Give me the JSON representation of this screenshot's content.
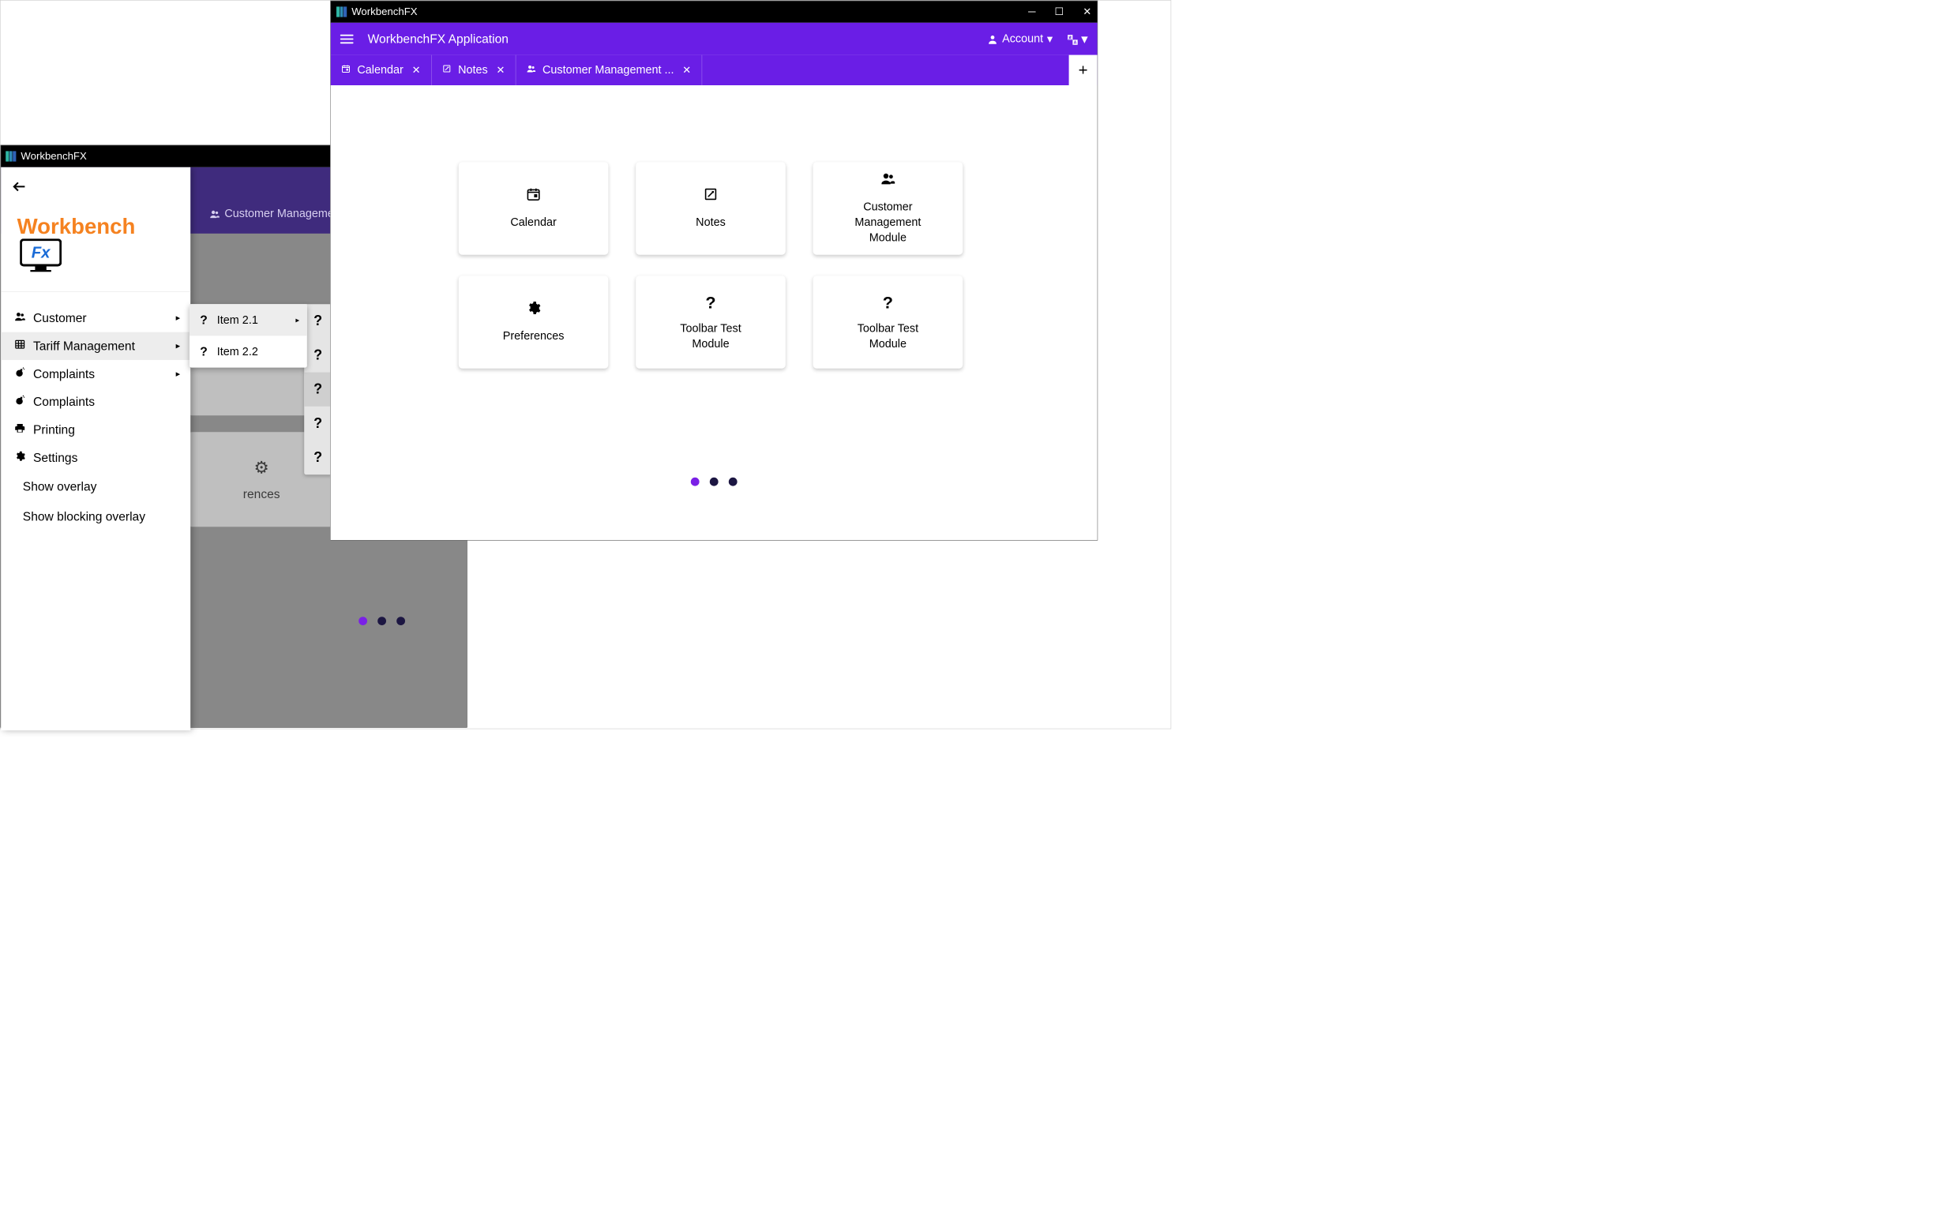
{
  "colors": {
    "accent": "#6a1ee6",
    "accent_dark": "#3f2b7d",
    "dot_active": "#7a20e6",
    "dot_dark": "#1c1642"
  },
  "back_window": {
    "title": "WorkbenchFX",
    "tab_remnant": "Customer Managemen",
    "tile_label": "rences",
    "submenu_placeholders": [
      "?",
      "?",
      "?",
      "?",
      "?"
    ],
    "logo_text": "Workbench",
    "drawer": {
      "items": [
        {
          "icon": "people",
          "label": "Customer",
          "has_children": true
        },
        {
          "icon": "grid",
          "label": "Tariff Management",
          "has_children": true,
          "active": true
        },
        {
          "icon": "bomb",
          "label": "Complaints",
          "has_children": true
        },
        {
          "icon": "bomb",
          "label": "Complaints",
          "has_children": false
        },
        {
          "icon": "print",
          "label": "Printing",
          "has_children": false
        },
        {
          "icon": "gear",
          "label": "Settings",
          "has_children": false
        }
      ],
      "plain": [
        "Show overlay",
        "Show blocking overlay"
      ]
    },
    "flyout": [
      {
        "label": "Item 2.1",
        "has_children": true,
        "active": true
      },
      {
        "label": "Item 2.2",
        "has_children": false
      }
    ]
  },
  "front_window": {
    "title": "WorkbenchFX",
    "app_title": "WorkbenchFX Application",
    "account_label": "Account",
    "tabs": [
      {
        "icon": "calendar",
        "label": "Calendar"
      },
      {
        "icon": "note",
        "label": "Notes"
      },
      {
        "icon": "people",
        "label": "Customer Management ..."
      }
    ],
    "tiles": [
      {
        "icon": "calendar",
        "label": "Calendar"
      },
      {
        "icon": "note",
        "label": "Notes"
      },
      {
        "icon": "people",
        "label": "Customer Management Module"
      },
      {
        "icon": "gear",
        "label": "Preferences"
      },
      {
        "icon": "question",
        "label": "Toolbar Test Module"
      },
      {
        "icon": "question",
        "label": "Toolbar Test Module"
      }
    ]
  }
}
